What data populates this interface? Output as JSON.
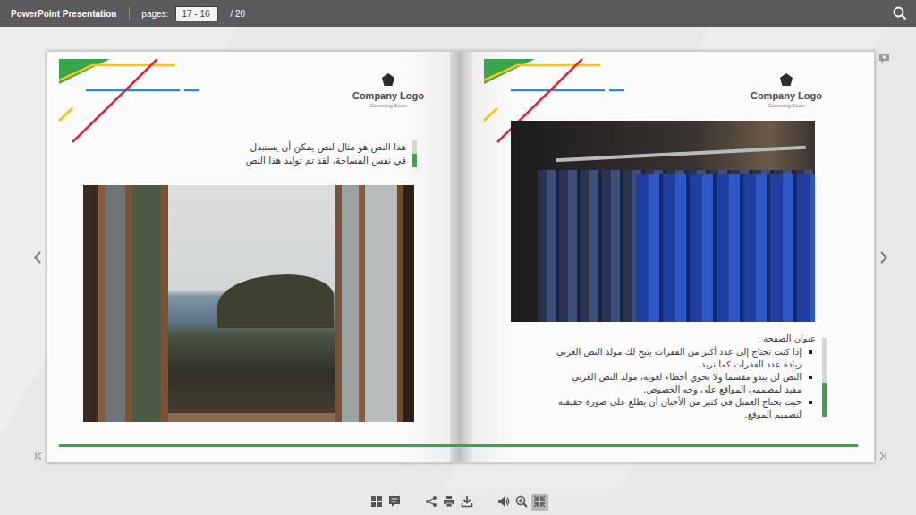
{
  "topbar": {
    "title": "PowerPoint Presentation",
    "pages_label": "pages:",
    "pages_value": "17 - 16",
    "pages_total": "/ 20"
  },
  "book": {
    "left_page": {
      "logo": {
        "title": "Company Logo",
        "subtitle": "Comming Soon"
      },
      "text_lines": [
        "هذا النص هو مثال لنص يمكن أن يستبدل",
        "في نفس المساحة، لقد تم توليد هذا النص"
      ]
    },
    "right_page": {
      "logo": {
        "title": "Company Logo",
        "subtitle": "Comming Soon"
      },
      "heading": "عنوان الصفحة :",
      "bullets": [
        "إذا كنت تحتاج إلى عدد أكبر من الفقرات يتيح لك مولد النص العربي زيادة عدد الفقرات كما تريد.",
        "النص لن يبدو مقسما ولا يحوي أخطاء لغوية، مولد النص العربي مفيد لمصممي المواقع على وجه الخصوص.",
        "حيث يحتاج العميل فى كثير من الأحيان أن يطلع على صورة حقيقية لتصميم الموقع."
      ]
    }
  },
  "toolbar": {
    "buttons": [
      {
        "selected": false
      },
      {
        "selected": false
      },
      {
        "selected": false
      },
      {
        "selected": false
      },
      {
        "selected": false
      },
      {
        "selected": false
      },
      {
        "selected": false
      },
      {
        "selected": true
      }
    ]
  }
}
